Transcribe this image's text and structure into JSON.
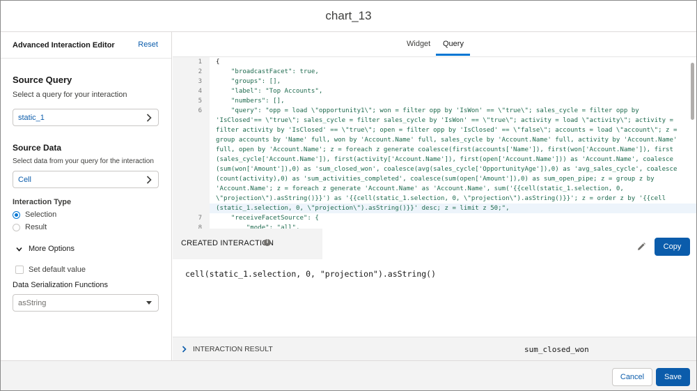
{
  "window": {
    "title": "chart_13"
  },
  "left_panel": {
    "title": "Advanced Interaction Editor",
    "reset_label": "Reset",
    "source_query": {
      "title": "Source Query",
      "description": "Select a query for your interaction",
      "value": "static_1"
    },
    "source_data": {
      "title": "Source Data",
      "description": "Select data from your query for the interaction",
      "value": "Cell"
    },
    "interaction_type": {
      "title": "Interaction Type",
      "options": [
        "Selection",
        "Result"
      ],
      "selected": "Selection"
    },
    "more_options_label": "More Options",
    "set_default_label": "Set default value",
    "serialization": {
      "title": "Data Serialization Functions",
      "value": "asString"
    }
  },
  "right_panel": {
    "tabs": [
      {
        "label": "Widget",
        "active": false
      },
      {
        "label": "Query",
        "active": true
      }
    ],
    "code": {
      "line_numbers": [
        "1",
        "2",
        "3",
        "4",
        "5",
        "6",
        "7",
        "8"
      ],
      "lines": [
        "{",
        "    \"broadcastFacet\": true,",
        "    \"groups\": [],",
        "    \"label\": \"Top Accounts\",",
        "    \"numbers\": [],",
        "    \"query\": \"opp = load \\\"opportunity1\\\"; won = filter opp by 'IsWon' == \\\"true\\\"; sales_cycle = filter opp by",
        "'IsClosed'== \\\"true\\\"; sales_cycle = filter sales_cycle by 'IsWon' == \\\"true\\\"; activity = load \\\"activity\\\"; activity =",
        "filter activity by 'IsClosed' == \\\"true\\\"; open = filter opp by 'IsClosed' == \\\"false\\\"; accounts = load \\\"account\\\"; z =",
        "group accounts by 'Name' full, won by 'Account.Name' full, sales_cycle by 'Account.Name' full, activity by 'Account.Name'",
        "full, open by 'Account.Name'; z = foreach z generate coalesce(first(accounts['Name']), first(won['Account.Name']), first",
        "(sales_cycle['Account.Name']), first(activity['Account.Name']), first(open['Account.Name'])) as 'Account.Name', coalesce",
        "(sum(won['Amount']),0) as 'sum_closed_won', coalesce(avg(sales_cycle['OpportunityAge']),0) as 'avg_sales_cycle', coalesce",
        "(count(activity),0) as 'sum_activities_completed', coalesce(sum(open['Amount']),0) as sum_open_pipe; z = group z by",
        "'Account.Name'; z = foreach z generate 'Account.Name' as 'Account.Name', sum('{{cell(static_1.selection, 0,",
        "\\\"projection\\\").asString()}}') as '{{cell(static_1.selection, 0, \\\"projection\\\").asString()}}'; z = order z by '{{cell",
        "(static_1.selection, 0, \\\"projection\\\").asString()}}' desc; z = limit z 50;\",",
        "    \"receiveFacetSource\": {",
        "        \"mode\": \"all\","
      ]
    },
    "created_interaction": {
      "title": "CREATED INTERACTION",
      "copy_label": "Copy",
      "expression": "cell(static_1.selection, 0, \"projection\").asString()"
    },
    "interaction_result": {
      "title": "INTERACTION RESULT",
      "value": "sum_closed_won"
    }
  },
  "footer": {
    "cancel_label": "Cancel",
    "save_label": "Save"
  },
  "colors": {
    "accent": "#0176d3",
    "brand_button": "#0b5cab",
    "code_string": "#1e6a4e"
  }
}
